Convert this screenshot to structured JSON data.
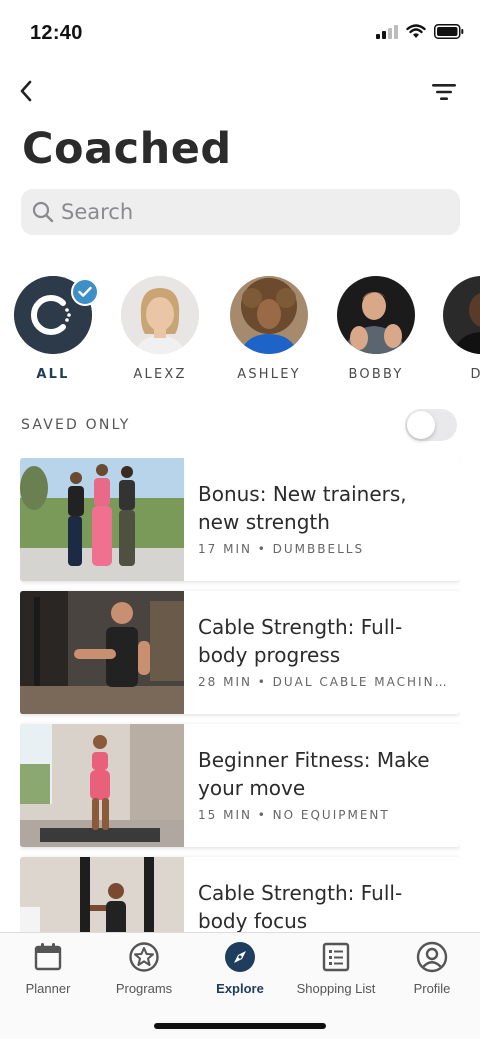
{
  "status_bar": {
    "time": "12:40"
  },
  "header": {
    "title": "Coached"
  },
  "search": {
    "placeholder": "Search"
  },
  "coaches": [
    {
      "label": "ALL",
      "selected": true
    },
    {
      "label": "ALEXZ"
    },
    {
      "label": "ASHLEY"
    },
    {
      "label": "BOBBY"
    },
    {
      "label": "DA"
    }
  ],
  "saved_only": {
    "label": "SAVED ONLY",
    "enabled": false
  },
  "workouts": [
    {
      "title": "Bonus: New trainers, new strength",
      "meta": "17 MIN • DUMBBELLS"
    },
    {
      "title": "Cable Strength: Full-body progress",
      "meta": "28 MIN • DUAL CABLE MACHIN…"
    },
    {
      "title": "Beginner Fitness: Make your move",
      "meta": "15 MIN • NO EQUIPMENT"
    },
    {
      "title": "Cable Strength: Full-body focus",
      "meta": ""
    }
  ],
  "tabs": [
    {
      "label": "Planner",
      "icon": "calendar-icon"
    },
    {
      "label": "Programs",
      "icon": "star-badge-icon"
    },
    {
      "label": "Explore",
      "icon": "compass-icon",
      "active": true
    },
    {
      "label": "Shopping List",
      "icon": "list-icon"
    },
    {
      "label": "Profile",
      "icon": "user-circle-icon"
    }
  ],
  "colors": {
    "accent": "#1f3d5c",
    "check": "#3d8fc6"
  }
}
